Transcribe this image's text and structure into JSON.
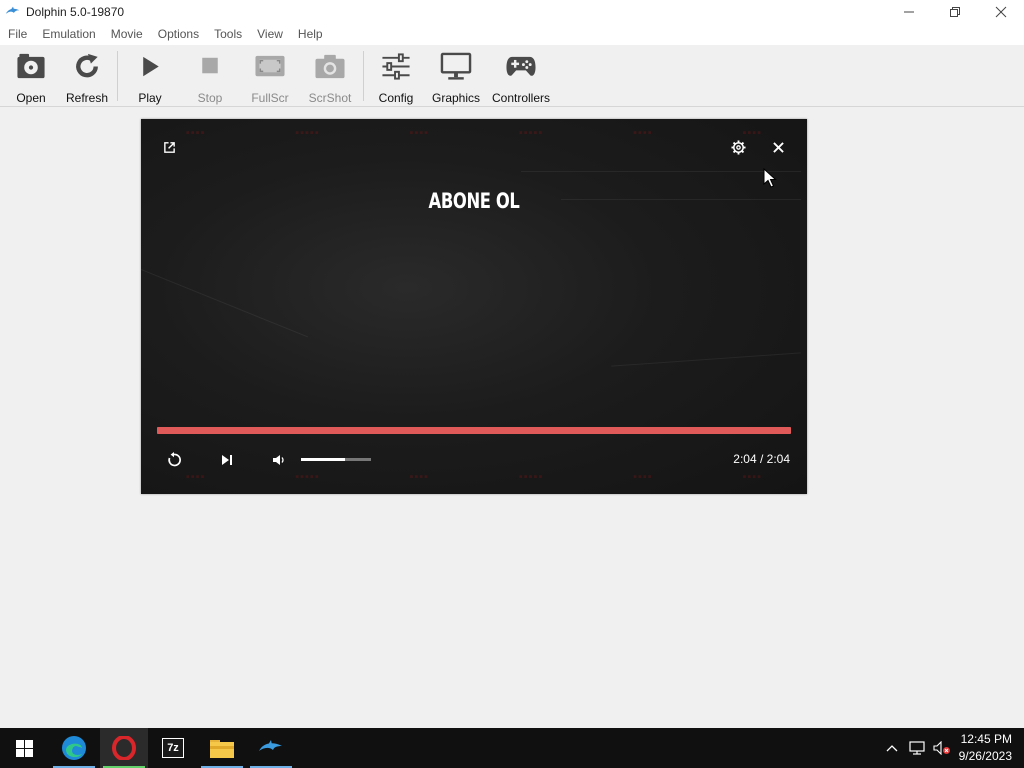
{
  "window": {
    "title": "Dolphin 5.0-19870"
  },
  "menu": [
    "File",
    "Emulation",
    "Movie",
    "Options",
    "Tools",
    "View",
    "Help"
  ],
  "toolbar": {
    "open": "Open",
    "refresh": "Refresh",
    "play": "Play",
    "stop": "Stop",
    "fullscr": "FullScr",
    "scrshot": "ScrShot",
    "config": "Config",
    "graphics": "Graphics",
    "controllers": "Controllers"
  },
  "player": {
    "title": "ABONE OL",
    "time_display": "2:04 / 2:04",
    "progress_fraction": 1.0,
    "volume_fraction": 0.63,
    "accent_color": "#e05a5a",
    "icons": [
      "open-external-icon",
      "settings-icon",
      "close-icon",
      "replay-icon",
      "next-icon",
      "volume-icon"
    ]
  },
  "taskbar": {
    "apps": [
      "start-icon",
      "edge-icon",
      "opera-icon",
      "7zip-icon",
      "file-explorer-icon",
      "dolphin-icon"
    ],
    "sevenzip_label": "7z",
    "time": "12:45 PM",
    "date": "9/26/2023"
  }
}
